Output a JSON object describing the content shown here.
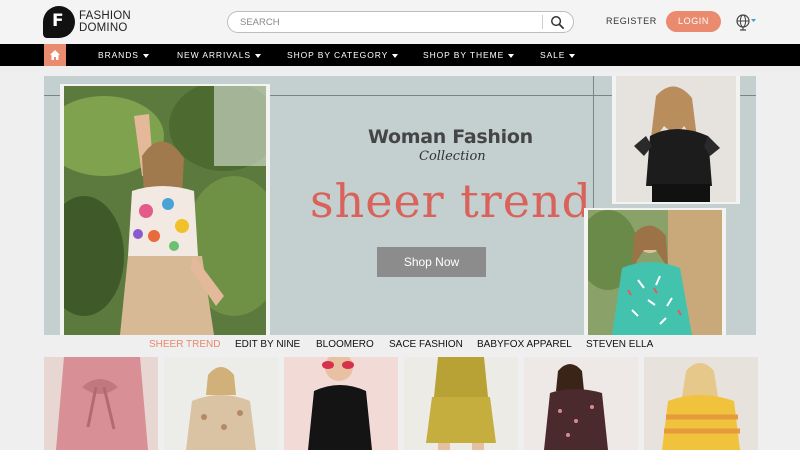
{
  "header": {
    "logo_line1": "FASHION",
    "logo_line2": "DOMINO",
    "search_placeholder": "SEARCH",
    "register_label": "REGISTER",
    "login_label": "LOGIN",
    "accent_color": "#ea8a6e"
  },
  "nav": {
    "items": [
      {
        "label": "BRANDS"
      },
      {
        "label": "NEW ARRIVALS"
      },
      {
        "label": "SHOP BY CATEGORY"
      },
      {
        "label": "SHOP BY THEME"
      },
      {
        "label": "SALE"
      }
    ]
  },
  "banner": {
    "title": "Woman Fashion",
    "subtitle": "Collection",
    "headline": "sheer trend",
    "button_label": "Shop Now",
    "headline_color": "#d9625b"
  },
  "brand_tabs": {
    "items": [
      {
        "label": "SHEER TREND",
        "active": true
      },
      {
        "label": "EDIT BY NINE",
        "active": false
      },
      {
        "label": "BLOOMERO",
        "active": false
      },
      {
        "label": "SACE FASHION",
        "active": false
      },
      {
        "label": "BABYFOX APPAREL",
        "active": false
      },
      {
        "label": "STEVEN ELLA",
        "active": false
      }
    ]
  }
}
